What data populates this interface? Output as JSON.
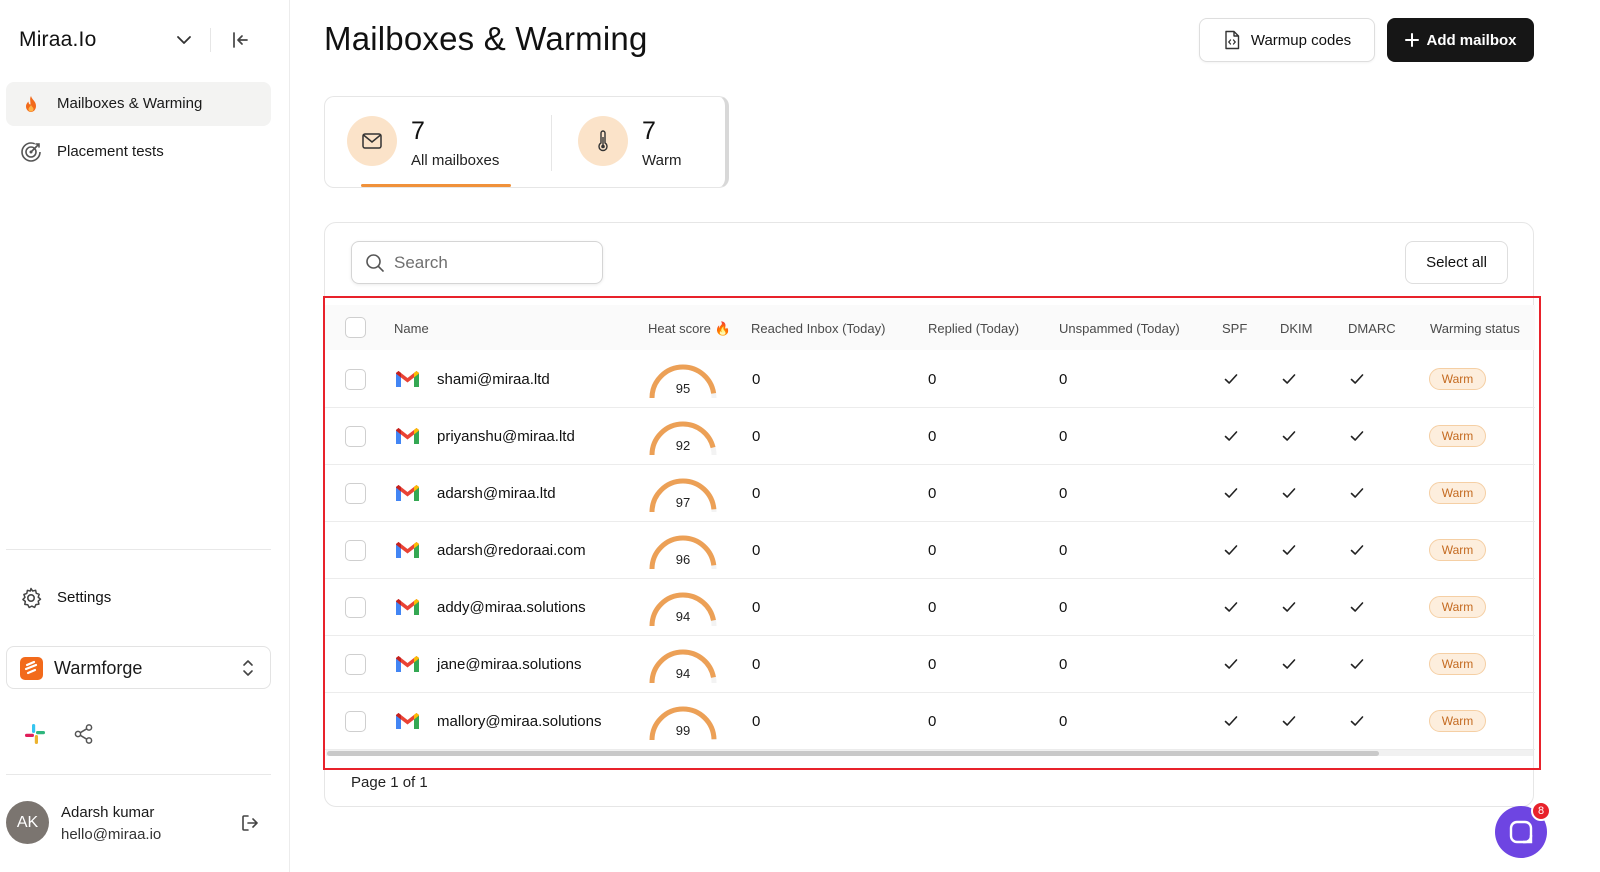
{
  "sidebar": {
    "brand": "Miraa.Io",
    "nav": [
      {
        "label": "Mailboxes & Warming",
        "icon": "fire-icon",
        "active": true
      },
      {
        "label": "Placement tests",
        "icon": "target-icon",
        "active": false
      }
    ],
    "settings_label": "Settings",
    "workspace_name": "Warmforge",
    "user": {
      "initials": "AK",
      "name": "Adarsh kumar",
      "email": "hello@miraa.io"
    }
  },
  "header": {
    "title": "Mailboxes & Warming",
    "warmup_codes_label": "Warmup codes",
    "add_mailbox_label": "Add mailbox"
  },
  "stats": [
    {
      "value": "7",
      "label": "All mailboxes",
      "icon": "mail-icon",
      "selected": true
    },
    {
      "value": "7",
      "label": "Warm",
      "icon": "thermometer-icon",
      "selected": false
    }
  ],
  "table": {
    "search_placeholder": "Search",
    "select_all_label": "Select all",
    "columns": {
      "name": "Name",
      "heat": "Heat score",
      "inbox": "Reached Inbox (Today)",
      "replied": "Replied (Today)",
      "unspammed": "Unspammed (Today)",
      "spf": "SPF",
      "dkim": "DKIM",
      "dmarc": "DMARC",
      "status": "Warming status"
    },
    "rows": [
      {
        "email": "shami@miraa.ltd",
        "heat": "95",
        "inbox": "0",
        "replied": "0",
        "unspammed": "0",
        "status": "Warm"
      },
      {
        "email": "priyanshu@miraa.ltd",
        "heat": "92",
        "inbox": "0",
        "replied": "0",
        "unspammed": "0",
        "status": "Warm"
      },
      {
        "email": "adarsh@miraa.ltd",
        "heat": "97",
        "inbox": "0",
        "replied": "0",
        "unspammed": "0",
        "status": "Warm"
      },
      {
        "email": "adarsh@redoraai.com",
        "heat": "96",
        "inbox": "0",
        "replied": "0",
        "unspammed": "0",
        "status": "Warm"
      },
      {
        "email": "addy@miraa.solutions",
        "heat": "94",
        "inbox": "0",
        "replied": "0",
        "unspammed": "0",
        "status": "Warm"
      },
      {
        "email": "jane@miraa.solutions",
        "heat": "94",
        "inbox": "0",
        "replied": "0",
        "unspammed": "0",
        "status": "Warm"
      },
      {
        "email": "mallory@miraa.solutions",
        "heat": "99",
        "inbox": "0",
        "replied": "0",
        "unspammed": "0",
        "status": "Warm"
      }
    ],
    "pager": "Page 1 of 1"
  },
  "chat": {
    "badge_count": "8"
  },
  "colors": {
    "accent": "#f0913a",
    "dark_button": "#161616",
    "warm_badge_bg": "#fdeedd",
    "chat": "#6e45e2",
    "highlight": "#e8222b"
  }
}
